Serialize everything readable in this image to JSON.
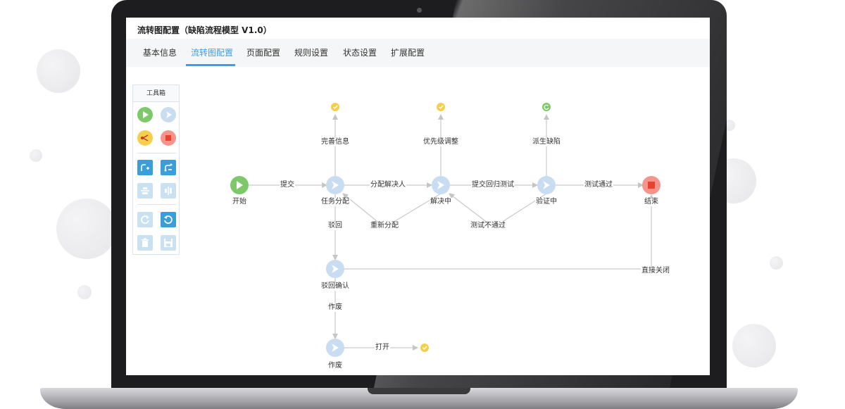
{
  "app": {
    "title": "流转图配置（缺陷流程模型  V1.0）"
  },
  "tabs": [
    {
      "label": "基本信息",
      "active": false
    },
    {
      "label": "流转图配置",
      "active": true
    },
    {
      "label": "页面配置",
      "active": false
    },
    {
      "label": "规则设置",
      "active": false
    },
    {
      "label": "状态设置",
      "active": false
    },
    {
      "label": "扩展配置",
      "active": false
    }
  ],
  "toolbox": {
    "title": "工具箱",
    "tools": [
      {
        "name": "start-node",
        "icon": "play-icon",
        "color": "#7dc96a"
      },
      {
        "name": "task-node",
        "icon": "arrow-icon",
        "color": "#c8dcf2"
      },
      {
        "name": "branch-node",
        "icon": "fork-icon",
        "color": "#f5cf4b"
      },
      {
        "name": "end-node",
        "icon": "stop-icon",
        "color": "#f6938a"
      },
      {
        "name": "add-line",
        "icon": "add-line-icon",
        "color": "#3a9ed9"
      },
      {
        "name": "edit-line",
        "icon": "edit-line-icon",
        "color": "#3a9ed9"
      },
      {
        "name": "align-horizontal",
        "icon": "align-h-icon",
        "color": "#c9e1f0"
      },
      {
        "name": "align-vertical",
        "icon": "align-v-icon",
        "color": "#c9e1f0"
      },
      {
        "name": "redo",
        "icon": "redo-icon",
        "color": "#c9e1f0"
      },
      {
        "name": "undo",
        "icon": "undo-icon",
        "color": "#3a9ed9"
      },
      {
        "name": "delete",
        "icon": "trash-icon",
        "color": "#c9e1f0"
      },
      {
        "name": "save",
        "icon": "save-icon",
        "color": "#c9e1f0"
      }
    ]
  },
  "flow": {
    "nodes": {
      "start": "开始",
      "assign": "任务分配",
      "resolve": "解决中",
      "verify": "验证中",
      "end": "结束",
      "reject_confirm": "驳回确认",
      "void": "作废"
    },
    "status_labels": {
      "improve_info": "完善信息",
      "adjust_priority": "优先级调整",
      "derive_defect": "派生缺陷"
    },
    "edges": {
      "submit": "提交",
      "assign_resolver": "分配解决人",
      "submit_regression": "提交回归测试",
      "test_pass": "测试通过",
      "reassign": "重新分配",
      "test_fail": "测试不通过",
      "reject": "驳回",
      "close_direct": "直接关闭",
      "void": "作废",
      "open": "打开"
    },
    "colors": {
      "start": "#7dc96a",
      "task": "#c8dcf2",
      "end": "#f6938a",
      "check": "#f5cf4b",
      "derive": "#7dc96a",
      "line": "#c5c5c5"
    }
  }
}
